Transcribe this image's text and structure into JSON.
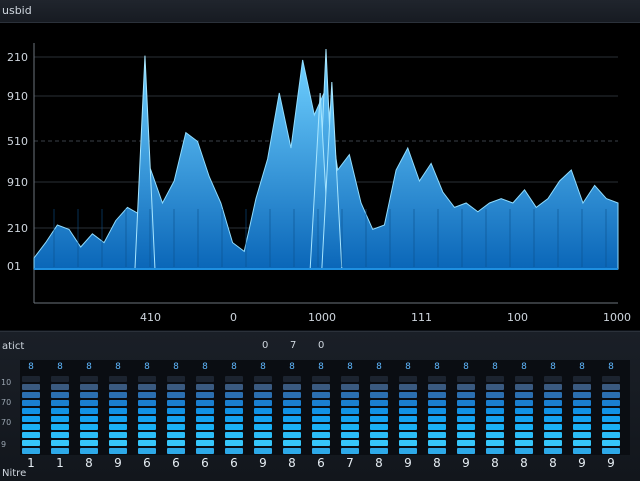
{
  "window": {
    "title": "usbid"
  },
  "chart_data": {
    "type": "area",
    "title": "",
    "xlabel": "",
    "ylabel": "",
    "y_tick_labels": [
      "210",
      "910",
      "510",
      "910",
      "210",
      "01"
    ],
    "x_tick_labels": [
      "410",
      "0",
      "1000",
      "111",
      "100",
      "1000"
    ],
    "ylim": [
      0,
      1
    ],
    "grid": true,
    "color": "#29a8ff",
    "x": [
      0,
      0.02,
      0.04,
      0.06,
      0.08,
      0.1,
      0.12,
      0.14,
      0.16,
      0.18,
      0.2,
      0.22,
      0.24,
      0.26,
      0.28,
      0.3,
      0.32,
      0.34,
      0.36,
      0.38,
      0.4,
      0.42,
      0.44,
      0.46,
      0.48,
      0.5,
      0.52,
      0.54,
      0.56,
      0.58,
      0.6,
      0.62,
      0.64,
      0.66,
      0.68,
      0.7,
      0.72,
      0.74,
      0.76,
      0.78,
      0.8,
      0.82,
      0.84,
      0.86,
      0.88,
      0.9,
      0.92,
      0.94,
      0.96,
      0.98,
      1.0
    ],
    "values": [
      0.05,
      0.12,
      0.2,
      0.18,
      0.1,
      0.16,
      0.12,
      0.22,
      0.28,
      0.25,
      0.45,
      0.3,
      0.4,
      0.62,
      0.58,
      0.42,
      0.3,
      0.12,
      0.08,
      0.32,
      0.5,
      0.8,
      0.55,
      0.95,
      0.7,
      0.82,
      0.45,
      0.52,
      0.3,
      0.18,
      0.2,
      0.45,
      0.55,
      0.4,
      0.48,
      0.35,
      0.28,
      0.3,
      0.26,
      0.3,
      0.32,
      0.3,
      0.36,
      0.28,
      0.32,
      0.4,
      0.45,
      0.3,
      0.38,
      0.32,
      0.3
    ],
    "peaks": [
      {
        "x": 0.19,
        "y": 0.97
      },
      {
        "x": 0.5,
        "y": 1.0
      },
      {
        "x": 0.49,
        "y": 0.8
      },
      {
        "x": 0.51,
        "y": 0.85
      }
    ]
  },
  "meters": {
    "header_label": "atict",
    "top_numbers": [
      "0",
      "7",
      "0"
    ],
    "side_ticks": [
      "10",
      "70",
      "70",
      "9"
    ],
    "footer_label": "Nitre",
    "channels": [
      {
        "top": "8",
        "bottom": "1",
        "level": 0.9
      },
      {
        "top": "8",
        "bottom": "1",
        "level": 0.85
      },
      {
        "top": "8",
        "bottom": "8",
        "level": 0.9
      },
      {
        "top": "8",
        "bottom": "9",
        "level": 0.88
      },
      {
        "top": "8",
        "bottom": "6",
        "level": 0.9
      },
      {
        "top": "8",
        "bottom": "6",
        "level": 0.86
      },
      {
        "top": "8",
        "bottom": "6",
        "level": 0.9
      },
      {
        "top": "8",
        "bottom": "6",
        "level": 0.88
      },
      {
        "top": "8",
        "bottom": "9",
        "level": 0.9
      },
      {
        "top": "8",
        "bottom": "8",
        "level": 0.85
      },
      {
        "top": "8",
        "bottom": "6",
        "level": 0.9
      },
      {
        "top": "8",
        "bottom": "7",
        "level": 0.87
      },
      {
        "top": "8",
        "bottom": "8",
        "level": 0.9
      },
      {
        "top": "8",
        "bottom": "9",
        "level": 0.88
      },
      {
        "top": "8",
        "bottom": "8",
        "level": 0.9
      },
      {
        "top": "8",
        "bottom": "9",
        "level": 0.86
      },
      {
        "top": "8",
        "bottom": "8",
        "level": 0.9
      },
      {
        "top": "8",
        "bottom": "8",
        "level": 0.85
      },
      {
        "top": "8",
        "bottom": "8",
        "level": 0.9
      },
      {
        "top": "8",
        "bottom": "9",
        "level": 0.88
      },
      {
        "top": "8",
        "bottom": "9",
        "level": 0.87
      }
    ]
  }
}
